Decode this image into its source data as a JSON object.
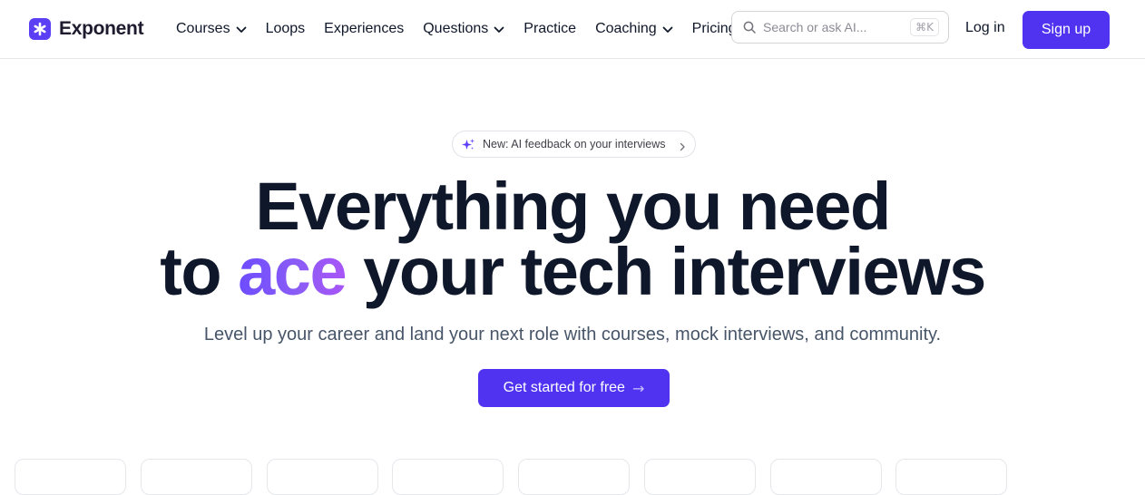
{
  "brand": {
    "name": "Exponent",
    "accent_color": "#4f33f0"
  },
  "nav": {
    "items": [
      {
        "label": "Courses",
        "has_dropdown": true
      },
      {
        "label": "Loops",
        "has_dropdown": false
      },
      {
        "label": "Experiences",
        "has_dropdown": false
      },
      {
        "label": "Questions",
        "has_dropdown": true
      },
      {
        "label": "Practice",
        "has_dropdown": false
      },
      {
        "label": "Coaching",
        "has_dropdown": true
      },
      {
        "label": "Pricing",
        "has_dropdown": false
      }
    ]
  },
  "search": {
    "placeholder": "Search or ask AI...",
    "shortcut": "⌘K"
  },
  "auth": {
    "login_label": "Log in",
    "signup_label": "Sign up"
  },
  "hero": {
    "badge_text": "New: AI feedback on your interviews",
    "headline_line1": "Everything you need",
    "headline_line2_pre": "to ",
    "headline_accent": "ace",
    "headline_line2_post": " your tech interviews",
    "subtitle": "Level up your career and land your next role with courses, mock interviews, and community.",
    "cta_label": "Get started for free",
    "cta_arrow": "→"
  },
  "icons": {
    "logo": "asterisk-logo-icon",
    "search": "search-icon",
    "badge": "sparkle-icon",
    "dropdown": "chevron-down-icon",
    "badge_chevron": "chevron-right-icon"
  }
}
